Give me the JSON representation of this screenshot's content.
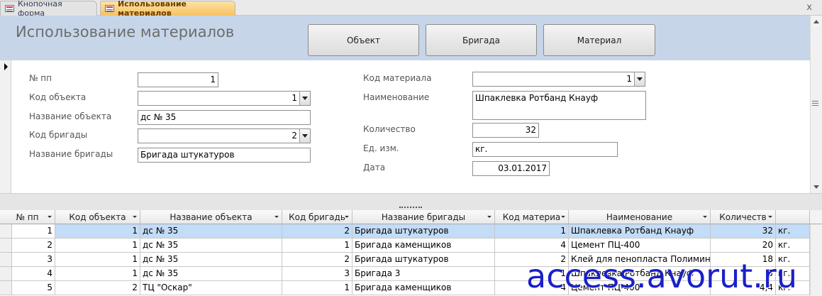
{
  "tabs": [
    {
      "label": "Кнопочная форма",
      "active": false,
      "icon": "form-icon"
    },
    {
      "label": "Использование материалов",
      "active": true,
      "icon": "form-icon"
    }
  ],
  "close_glyph": "x",
  "header": {
    "title": "Использование материалов",
    "buttons": [
      "Объект",
      "Бригада",
      "Материал"
    ]
  },
  "form": {
    "fields_left": [
      {
        "label": "№ пп",
        "value": "1",
        "kind": "number"
      },
      {
        "label": "Код объекта",
        "value": "1",
        "kind": "combo"
      },
      {
        "label": "Название объекта",
        "value": "дс № 35",
        "kind": "text"
      },
      {
        "label": "Код бригады",
        "value": "2",
        "kind": "combo"
      },
      {
        "label": "Название бригады",
        "value": "Бригада штукатуров",
        "kind": "text"
      }
    ],
    "fields_right": [
      {
        "label": "Код материала",
        "value": "1",
        "kind": "combo"
      },
      {
        "label": "Наименование",
        "value": "Шпаклевка Ротбанд Кнауф",
        "kind": "memo"
      },
      {
        "label": "Количество",
        "value": "32",
        "kind": "number"
      },
      {
        "label": "Ед. изм.",
        "value": "кг.",
        "kind": "text"
      },
      {
        "label": "Дата",
        "value": "03.01.2017",
        "kind": "number"
      }
    ]
  },
  "datasheet": {
    "columns": [
      "№ пп",
      "Код объекта",
      "Название объекта",
      "Код бригадь",
      "Название бригады",
      "Код материа",
      "Наименование",
      "Количеств",
      ""
    ],
    "rows": [
      [
        "1",
        "1",
        "дс № 35",
        "2",
        "Бригада штукатуров",
        "1",
        "Шпаклевка Ротбанд Кнауф",
        "32",
        "кг."
      ],
      [
        "2",
        "1",
        "дс № 35",
        "1",
        "Бригада каменщиков",
        "4",
        "Цемент ПЦ-400",
        "20",
        "кг."
      ],
      [
        "3",
        "1",
        "дс № 35",
        "2",
        "Бригада штукатуров",
        "2",
        "Клей для пенопласта Полимин",
        "18",
        "кг."
      ],
      [
        "4",
        "1",
        "дс № 35",
        "3",
        "Бригада 3",
        "1",
        "Шпаклевка Ротбанд Кнауф",
        "5",
        "кг."
      ],
      [
        "5",
        "2",
        "ТЦ \"Оскар\"",
        "1",
        "Бригада каменщиков",
        "4",
        "Цемент ПЦ-400",
        "4,4",
        "кг."
      ]
    ],
    "selected_row": 0
  },
  "watermark": "access.avorut.ru",
  "colors": {
    "header_bg": "#c7d5e9",
    "active_tab": "#fbd486",
    "selected_row": "#c3dcf7",
    "watermark": "#1a20c8"
  }
}
